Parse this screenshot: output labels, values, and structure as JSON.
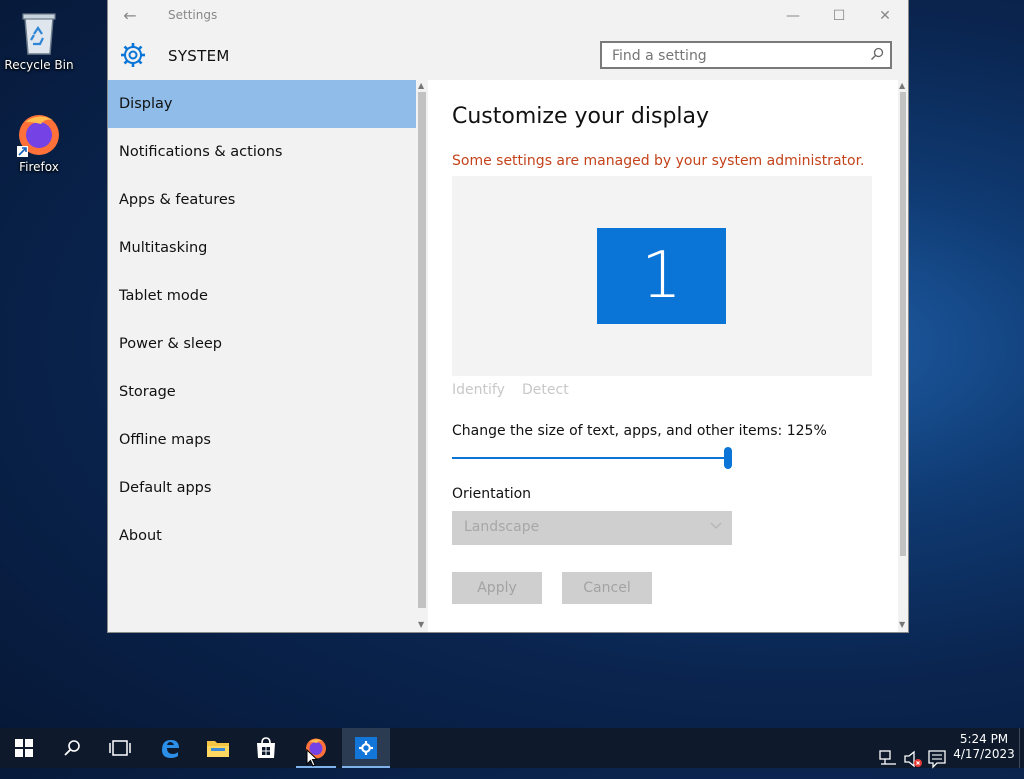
{
  "desktop": {
    "icons": [
      {
        "label": "Recycle Bin",
        "icon": "recycle-bin-icon"
      },
      {
        "label": "Firefox",
        "icon": "firefox-icon"
      }
    ]
  },
  "window": {
    "title": "Settings",
    "header": "SYSTEM",
    "search_placeholder": "Find a setting"
  },
  "sidebar": {
    "items": [
      {
        "label": "Display",
        "selected": true
      },
      {
        "label": "Notifications & actions"
      },
      {
        "label": "Apps & features"
      },
      {
        "label": "Multitasking"
      },
      {
        "label": "Tablet mode"
      },
      {
        "label": "Power & sleep"
      },
      {
        "label": "Storage"
      },
      {
        "label": "Offline maps"
      },
      {
        "label": "Default apps"
      },
      {
        "label": "About"
      }
    ]
  },
  "display": {
    "heading": "Customize your display",
    "warning": "Some settings are managed by your system administrator.",
    "monitor_number": "1",
    "identify": "Identify",
    "detect": "Detect",
    "scale_label": "Change the size of text, apps, and other items: 125%",
    "scale_slider_fraction": 1.0,
    "orientation_label": "Orientation",
    "orientation_value": "Landscape",
    "apply": "Apply",
    "cancel": "Cancel"
  },
  "colors": {
    "accent": "#0a75d7",
    "warning": "#c4431b",
    "selected_nav": "#8fbce8"
  },
  "taskbar": {
    "time": "5:24 PM",
    "date": "4/17/2023"
  }
}
